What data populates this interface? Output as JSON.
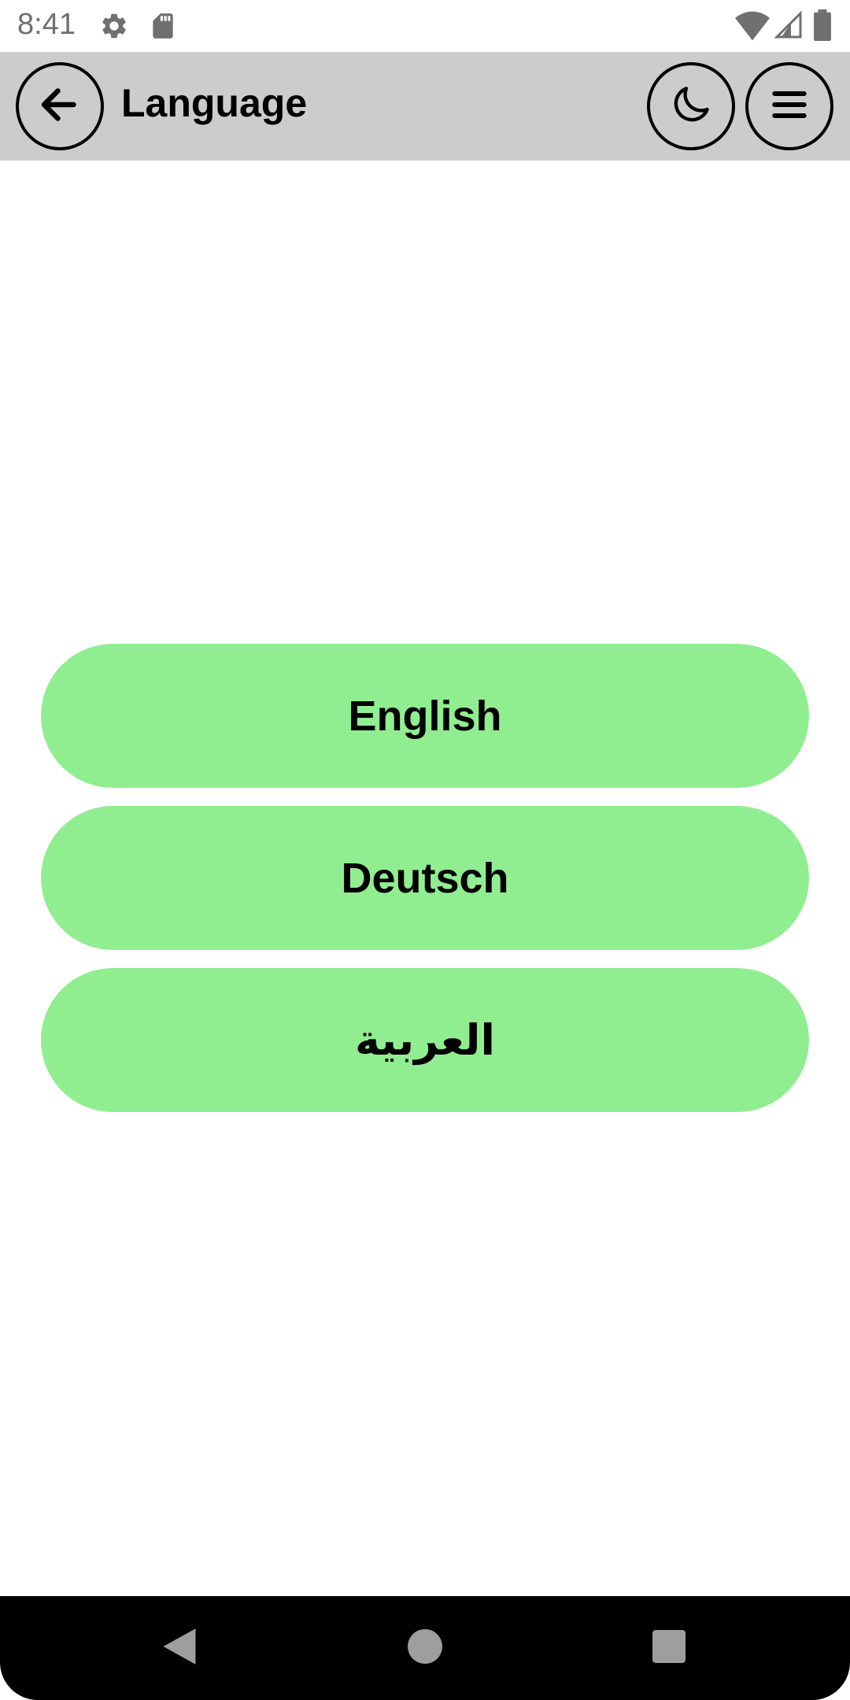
{
  "status_bar": {
    "time": "8:41",
    "icons": [
      "settings-icon",
      "sd-card-icon",
      "wifi-icon",
      "signal-icon",
      "battery-icon"
    ]
  },
  "app_bar": {
    "title": "Language",
    "back_icon": "arrow-left-icon",
    "theme_icon": "moon-icon",
    "menu_icon": "hamburger-menu-icon"
  },
  "languages": [
    {
      "label": "English"
    },
    {
      "label": "Deutsch"
    },
    {
      "label": "العربية"
    }
  ],
  "nav_bar": {
    "icons": [
      "back-triangle-icon",
      "home-circle-icon",
      "recents-square-icon"
    ]
  },
  "colors": {
    "app_bar_bg": "#cccccc",
    "button_bg": "#90ee90",
    "nav_bar_bg": "#000000"
  }
}
